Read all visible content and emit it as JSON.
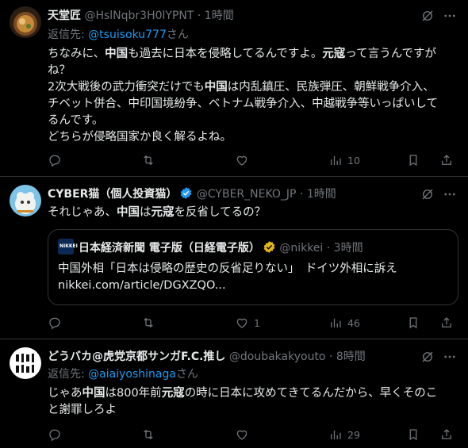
{
  "tweets": [
    {
      "display_name": "天堂匠",
      "handle": "@HslNqbr3H0lYPNT",
      "dot": "·",
      "time": "1時間",
      "reply_prefix": "返信先: ",
      "reply_mention": "@tsuisoku777",
      "reply_suffix": "さん",
      "body": [
        [
          "ちなみに、",
          "中国",
          "も過去に日本を侵略してるんですよ。",
          "元寇",
          "って言うんですが"
        ],
        [
          "ね？"
        ],
        [
          "2次大戦後の武力衝突だけでも",
          "中国",
          "は内乱鎮圧、民族弾圧、朝鮮戦争介入、"
        ],
        [
          "チベット併合、中印国境紛争、ベトナム戦争介入、中越戦争等いっぱいして"
        ],
        [
          "るんです。"
        ],
        [
          "どちらが侵略国家か良く解るよね。"
        ]
      ],
      "replies": "",
      "retweets": "",
      "likes": "",
      "views": "10"
    },
    {
      "display_name": "CYBER猫（個人投資猫）",
      "handle": "@CYBER_NEKO_JP",
      "dot": "·",
      "time": "1時間",
      "body": [
        [
          "それじゃあ、",
          "中国",
          "は",
          "元寇",
          "を反省してるの？"
        ]
      ],
      "quote": {
        "display_name": "日本経済新聞 電子版（日経電子版）",
        "handle": "@nikkei",
        "dot": "·",
        "time": "3時間",
        "avatar_text": "NIKKEI",
        "line1": "中国外相「日本は侵略の歴史の反省足りない」　ドイツ外相に訴え",
        "line2": "nikkei.com/article/DGXZQO..."
      },
      "replies": "",
      "retweets": "",
      "likes": "1",
      "views": "46"
    },
    {
      "display_name": "どうバカ@虎党京都サンガF.C.推し",
      "handle": "@doubakakyouto",
      "dot": "·",
      "time": "8時間",
      "reply_prefix": "返信先: ",
      "reply_mention": "@aiaiyoshinaga",
      "reply_suffix": "さん",
      "body": [
        [
          "じゃあ",
          "中国",
          "は800年前",
          "元寇",
          "の時に日本に攻めてきてるんだから、早くそのこ"
        ],
        [
          "と謝罪しろよ"
        ]
      ],
      "replies": "",
      "retweets": "",
      "likes": "",
      "views": "29"
    }
  ],
  "colors": {
    "text": "#e7e9ea",
    "muted": "#71767b",
    "link": "#1d9bf0",
    "divider": "#2f3336",
    "background": "#000000"
  }
}
